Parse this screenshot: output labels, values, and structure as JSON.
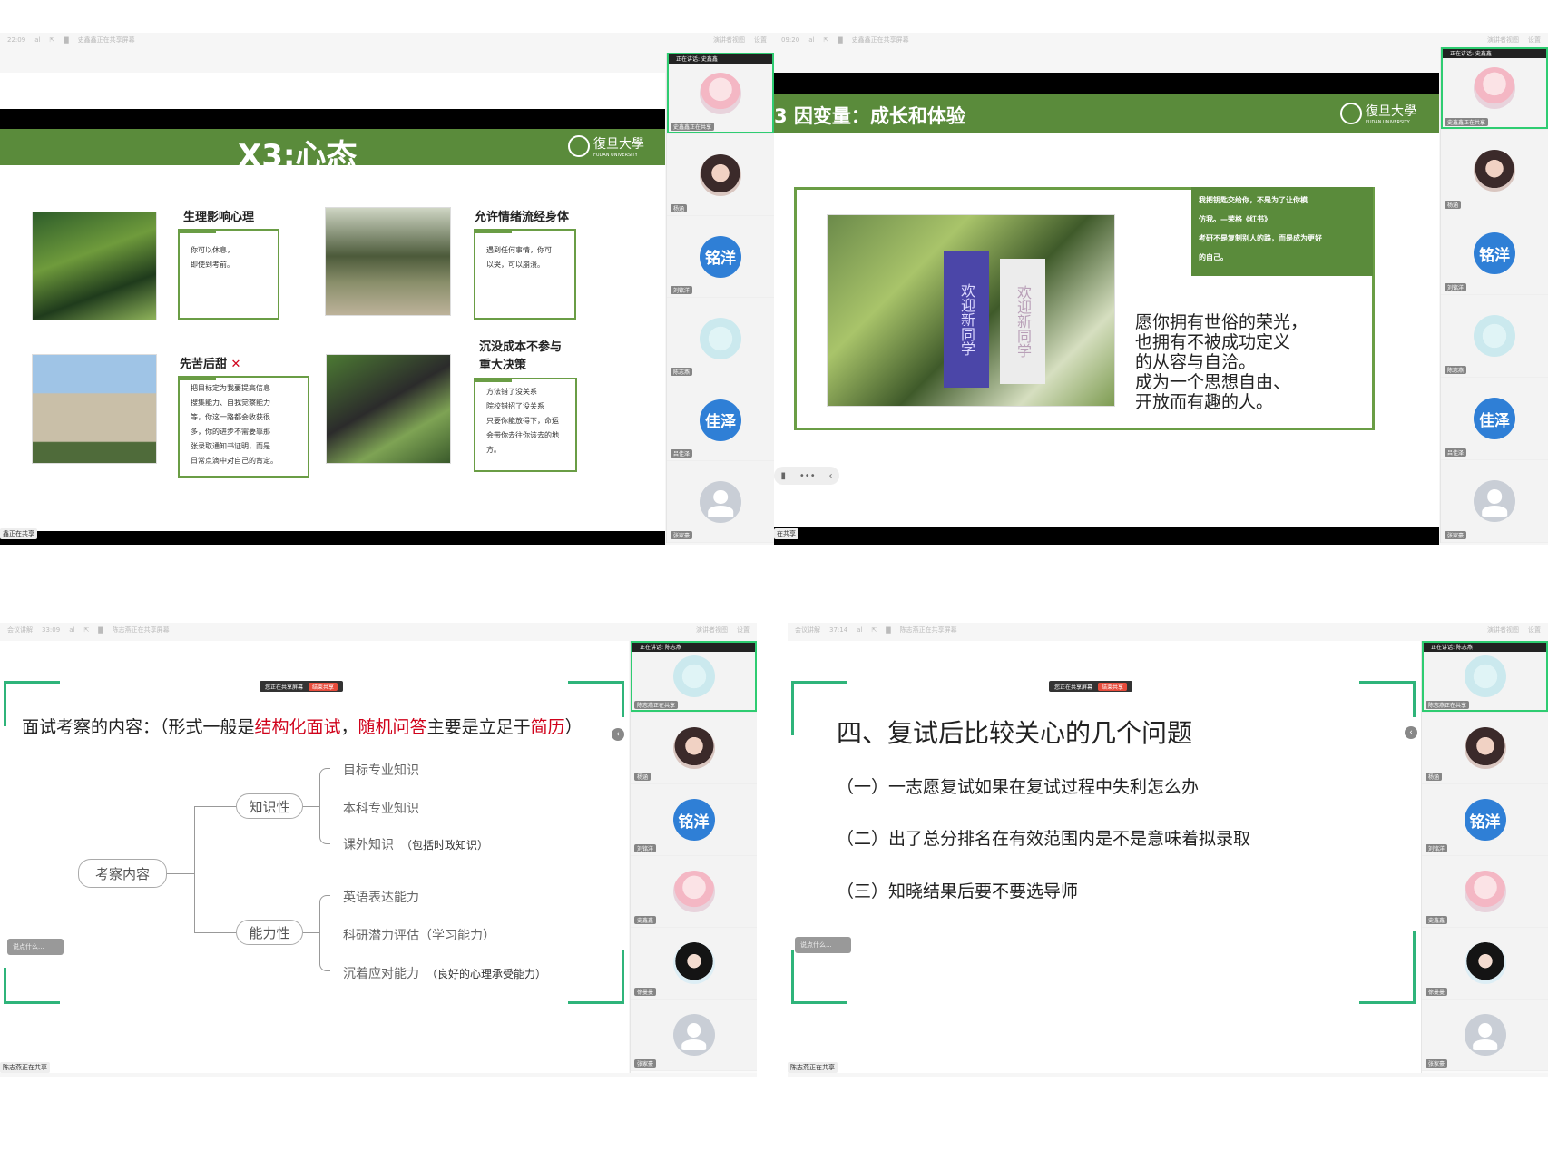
{
  "q1": {
    "topbar": {
      "left": [
        "22:09",
        "al",
        "⇱",
        "▇",
        "史鑫鑫正在共享屏幕"
      ],
      "right": [
        "演讲者视图",
        "设置"
      ]
    },
    "slide": {
      "title": "X3:心态",
      "logo": {
        "cn": "復旦大學",
        "en": "FUDAN UNIVERSITY"
      },
      "cards": [
        {
          "title": "生理影响心理",
          "lines": [
            "你可以休息，",
            "即使到考前。"
          ]
        },
        {
          "title": "允许情绪流经身体",
          "lines": [
            "遇到任何事情，你可",
            "以哭，可以崩溃。"
          ]
        },
        {
          "title": "先苦后甜",
          "mark": "✕",
          "lines": [
            "把目标定为我要提高信息",
            "搜集能力、自我觉察能力",
            "等，你这一路都会收获很",
            "多，你的进步不需要靠那",
            "张录取通知书证明，而是",
            "日常点滴中对自己的肯定。"
          ]
        },
        {
          "title_lines": [
            "沉没成本不参与",
            "重大决策"
          ],
          "lines": [
            "方法错了没关系",
            "院校错招了没关系",
            "只要你能放得下，命运",
            "会带你去往你该去的地",
            "方。"
          ]
        }
      ]
    },
    "share_tag": "鑫正在共享",
    "rail": {
      "speaker": "正在讲话: 史鑫鑫",
      "tiles": [
        {
          "name": "史鑫鑫正在共享",
          "avatar": "anime"
        },
        {
          "name": "杨涵",
          "avatar": "dark"
        },
        {
          "name": "刘铭洋",
          "avatar": "blue",
          "text": "铭洋"
        },
        {
          "name": "陈志燕",
          "avatar": "light"
        },
        {
          "name": "吕佳泽",
          "avatar": "blue",
          "text": "佳泽"
        },
        {
          "name": "张家豪",
          "avatar": "gray"
        }
      ]
    }
  },
  "q2": {
    "topbar": {
      "left": [
        "09:20",
        "al",
        "⇱",
        "▇",
        "史鑫鑫正在共享屏幕"
      ],
      "right": [
        "演讲者视图",
        "设置"
      ]
    },
    "slide": {
      "title": "3  因变量：成长和体验",
      "logo": {
        "cn": "復旦大學",
        "en": "FUDAN UNIVERSITY"
      },
      "quote_lines": [
        "我把钥匙交给你，不是为了让你模",
        "仿我。—荣格《红书》",
        "考研不是复制别人的路，而是成为更好",
        "的自己。"
      ],
      "body_lines": [
        "愿你拥有世俗的荣光，",
        "也拥有不被成功定义",
        "的从容与自洽。",
        "成为一个思想自由、",
        "开放而有趣的人。"
      ],
      "banner_left": "欢迎新同学",
      "banner_right": "欢迎新同学"
    },
    "share_tag": "在共享",
    "rail": {
      "speaker": "正在讲话: 史鑫鑫",
      "tiles": [
        {
          "name": "史鑫鑫正在共享",
          "avatar": "anime"
        },
        {
          "name": "杨涵",
          "avatar": "dark"
        },
        {
          "name": "刘铭洋",
          "avatar": "blue",
          "text": "铭洋"
        },
        {
          "name": "陈志燕",
          "avatar": "light"
        },
        {
          "name": "吕佳泽",
          "avatar": "blue",
          "text": "佳泽"
        },
        {
          "name": "张家豪",
          "avatar": "gray"
        }
      ]
    }
  },
  "q3": {
    "topbar": {
      "left": [
        "会议讲解",
        "33:09",
        "al",
        "⇱",
        "▇",
        "陈志燕正在共享屏幕"
      ],
      "right": [
        "演讲者视图",
        "设置"
      ]
    },
    "pillbar": {
      "text": "您正在共享屏幕",
      "end": "结束共享"
    },
    "heading": {
      "pre": "面试考察的内容：（形式一般是",
      "h1": "结构化面试",
      "mid1": "，",
      "h2": "随机问答",
      "mid2": "主要是立足于",
      "h3": "简历",
      "post": "）"
    },
    "root": "考察内容",
    "branches": [
      {
        "label": "知识性",
        "leaves": [
          {
            "text": "目标专业知识"
          },
          {
            "text": "本科专业知识"
          },
          {
            "text": "课外知识",
            "note": "（包括时政知识）"
          }
        ]
      },
      {
        "label": "能力性",
        "leaves": [
          {
            "text": "英语表达能力"
          },
          {
            "text": "科研潜力评估（学习能力）"
          },
          {
            "text": "沉着应对能力",
            "note": "（良好的心理承受能力）"
          }
        ]
      }
    ],
    "sidechip": "说点什么...",
    "share_tag": "陈志燕正在共享",
    "rail": {
      "speaker": "正在讲话: 陈志燕",
      "tiles": [
        {
          "name": "陈志燕正在共享",
          "avatar": "light"
        },
        {
          "name": "杨涵",
          "avatar": "dark"
        },
        {
          "name": "刘铭洋",
          "avatar": "blue",
          "text": "铭洋"
        },
        {
          "name": "史鑫鑫",
          "avatar": "anime"
        },
        {
          "name": "徐曼曼",
          "avatar": "girl"
        },
        {
          "name": "张家豪",
          "avatar": "gray"
        }
      ]
    }
  },
  "q4": {
    "topbar": {
      "left": [
        "会议讲解",
        "37:14",
        "al",
        "⇱",
        "▇",
        "陈志燕正在共享屏幕"
      ],
      "right": [
        "演讲者视图",
        "设置"
      ]
    },
    "pillbar": {
      "text": "您正在共享屏幕",
      "end": "结束共享"
    },
    "title": "四、复试后比较关心的几个问题",
    "items": [
      "（一）一志愿复试如果在复试过程中失利怎么办",
      "（二）出了总分排名在有效范围内是不是意味着拟录取",
      "（三）知晓结果后要不要选导师"
    ],
    "sidechip": "说点什么...",
    "share_tag": "陈志燕正在共享",
    "rail": {
      "speaker": "正在讲话: 陈志燕",
      "tiles": [
        {
          "name": "陈志燕正在共享",
          "avatar": "light"
        },
        {
          "name": "杨涵",
          "avatar": "dark"
        },
        {
          "name": "刘铭洋",
          "avatar": "blue",
          "text": "铭洋"
        },
        {
          "name": "史鑫鑫",
          "avatar": "anime"
        },
        {
          "name": "徐曼曼",
          "avatar": "girl"
        },
        {
          "name": "张家豪",
          "avatar": "gray"
        }
      ]
    }
  }
}
